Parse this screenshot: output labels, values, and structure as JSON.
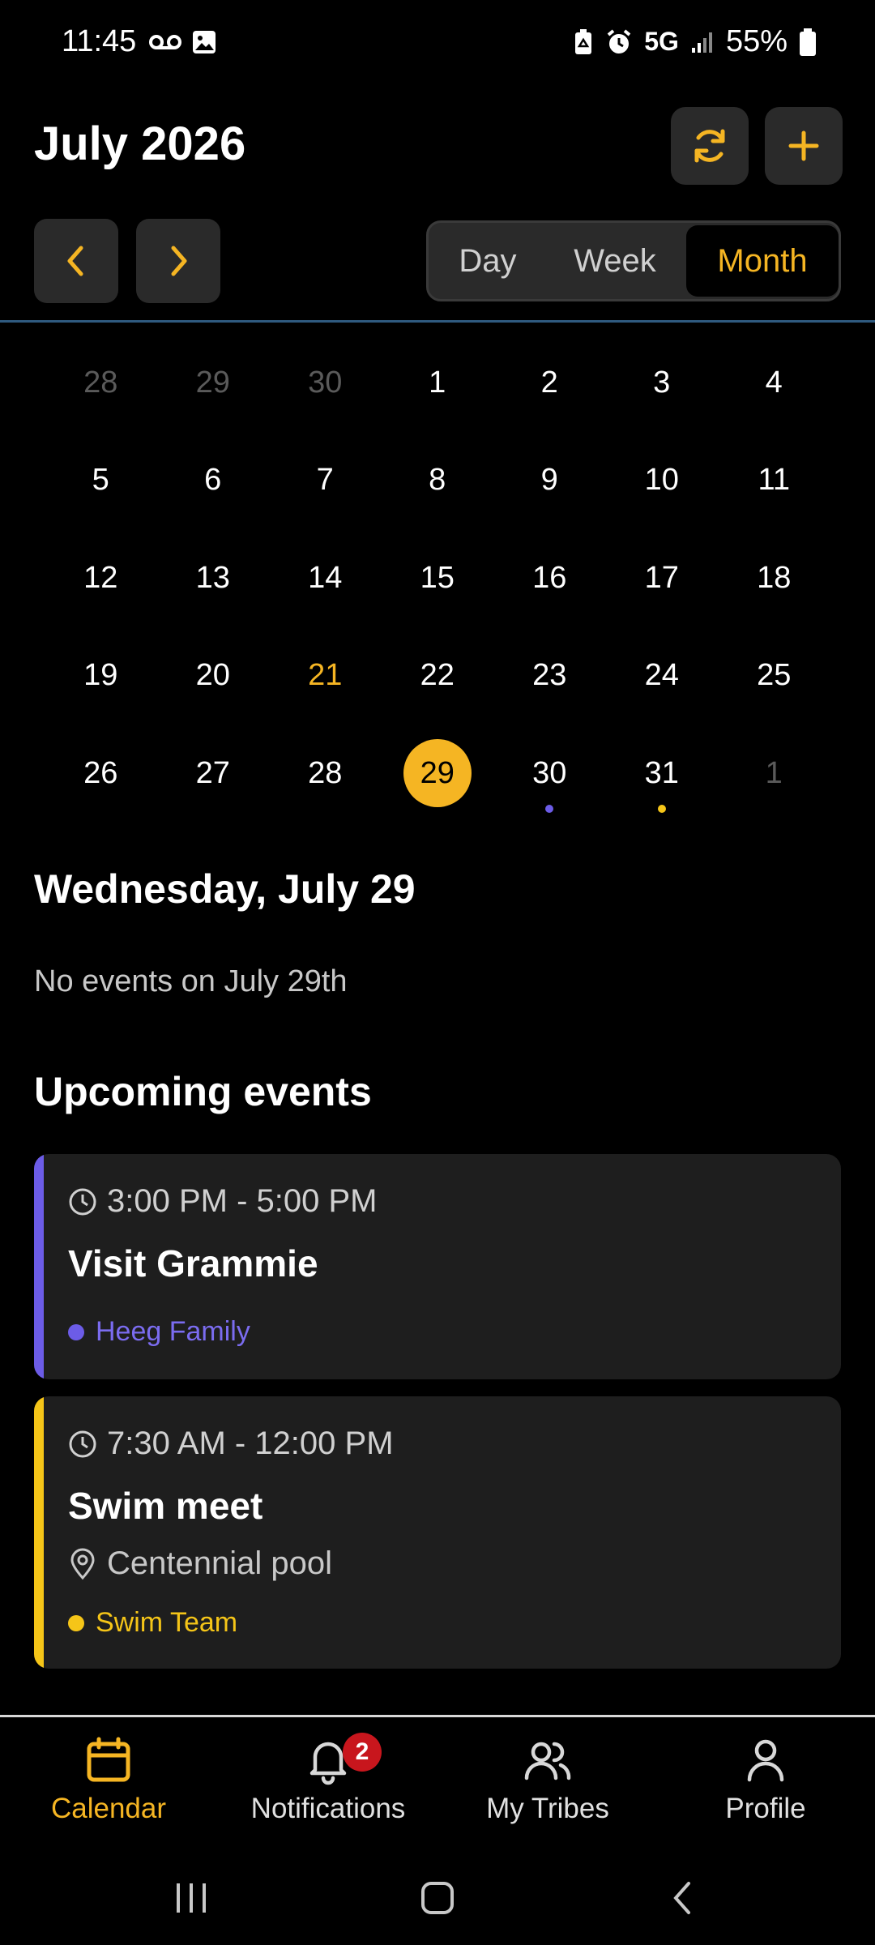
{
  "status_bar": {
    "time": "11:45",
    "network": "5G",
    "battery": "55%"
  },
  "header": {
    "title": "July 2026",
    "refresh_icon": "refresh-icon",
    "add_icon": "plus-icon"
  },
  "nav": {
    "prev_icon": "chevron-left-icon",
    "next_icon": "chevron-right-icon"
  },
  "view_switch": {
    "day": "Day",
    "week": "Week",
    "month": "Month",
    "selected": "Month"
  },
  "calendar": {
    "weeks": [
      [
        "28",
        "29",
        "30",
        "1",
        "2",
        "3",
        "4"
      ],
      [
        "5",
        "6",
        "7",
        "8",
        "9",
        "10",
        "11"
      ],
      [
        "12",
        "13",
        "14",
        "15",
        "16",
        "17",
        "18"
      ],
      [
        "19",
        "20",
        "21",
        "22",
        "23",
        "24",
        "25"
      ],
      [
        "26",
        "27",
        "28",
        "29",
        "30",
        "31",
        "1"
      ]
    ],
    "selected_day": "29",
    "highlighted_day": "21"
  },
  "selected_date": "Wednesday, July 29",
  "no_events": "No events on July 29th",
  "upcoming_title": "Upcoming events",
  "events": [
    {
      "time": "3:00 PM - 5:00 PM",
      "title": "Visit Grammie",
      "tribe": "Heeg Family",
      "color": "#6c5ce7"
    },
    {
      "time": "7:30 AM - 12:00 PM",
      "title": "Swim meet",
      "location": "Centennial pool",
      "tribe": "Swim Team",
      "color": "#f5c518"
    }
  ],
  "tabs": {
    "calendar": "Calendar",
    "notifications": "Notifications",
    "notifications_badge": "2",
    "tribes": "My Tribes",
    "profile": "Profile"
  },
  "colors": {
    "accent": "#f5b523",
    "background": "#000000",
    "card": "#1e1e1e",
    "badge": "#c8161d"
  }
}
